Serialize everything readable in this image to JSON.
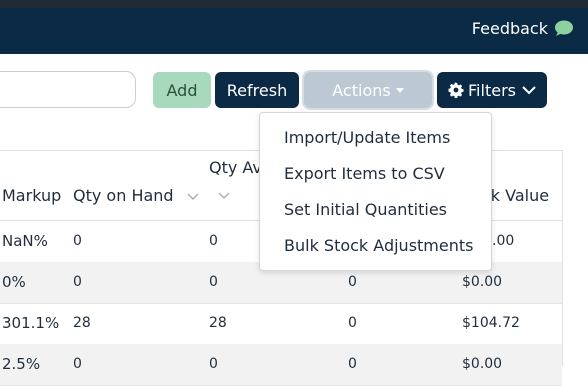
{
  "topbar": {
    "feedback_label": "Feedback"
  },
  "toolbar": {
    "search_value": "",
    "add_label": "Add",
    "refresh_label": "Refresh",
    "actions_label": "Actions",
    "filters_label": "Filters"
  },
  "table": {
    "headers": {
      "markup": "Markup",
      "qty_on_hand": "Qty on Hand",
      "qty_available": "Qty Av",
      "stock_value": "ck Value"
    },
    "rows": [
      {
        "markup": "NaN%",
        "qty_on_hand": "0",
        "qty_available": "0",
        "col4": "",
        "stock_value": ".00"
      },
      {
        "markup": "0%",
        "qty_on_hand": "0",
        "qty_available": "0",
        "col4": "0",
        "stock_value": "$0.00"
      },
      {
        "markup": "301.1%",
        "qty_on_hand": "28",
        "qty_available": "28",
        "col4": "0",
        "stock_value": "$104.72"
      },
      {
        "markup": "2.5%",
        "qty_on_hand": "0",
        "qty_available": "0",
        "col4": "0",
        "stock_value": "$0.00"
      }
    ]
  },
  "actions_menu": {
    "items": [
      "Import/Update Items",
      "Export Items to CSV",
      "Set Initial Quantities",
      "Bulk Stock Adjustments"
    ]
  },
  "colors": {
    "navy": "#0b2a45",
    "add_green": "#a8d9bd",
    "actions_disabled": "#bcc8d3",
    "feedback_icon": "#8fd19e"
  },
  "icons": [
    "speech-bubble-icon",
    "gear-icon",
    "chevron-down-icon"
  ]
}
